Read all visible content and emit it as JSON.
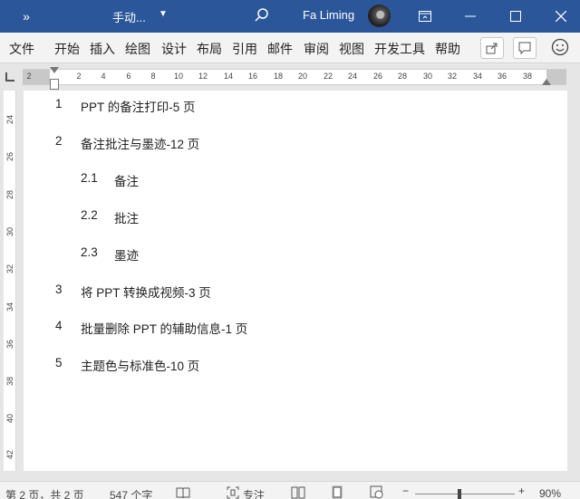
{
  "titlebar": {
    "qat_label": "»",
    "title": "手动...",
    "user_name": "Fa Liming",
    "colors": {
      "bg": "#2b579a"
    }
  },
  "ribbon": {
    "tabs": [
      "文件",
      "开始",
      "插入",
      "绘图",
      "设计",
      "布局",
      "引用",
      "邮件",
      "审阅",
      "视图",
      "开发工具",
      "帮助"
    ]
  },
  "ruler": {
    "h_numbers": [
      "2",
      "2",
      "4",
      "6",
      "8",
      "10",
      "12",
      "14",
      "16",
      "18",
      "20",
      "22",
      "24",
      "26",
      "28",
      "30",
      "32",
      "34",
      "36",
      "38"
    ],
    "v_numbers": [
      "24",
      "26",
      "28",
      "30",
      "32",
      "34",
      "36",
      "38",
      "40",
      "42"
    ]
  },
  "document": {
    "toc": [
      {
        "num": "1",
        "text": "PPT 的备注打印-5 页"
      },
      {
        "num": "2",
        "text": "备注批注与墨迹-12 页"
      },
      {
        "num": "2.1",
        "text": "备注"
      },
      {
        "num": "2.2",
        "text": "批注"
      },
      {
        "num": "2.3",
        "text": "墨迹"
      },
      {
        "num": "3",
        "text": "将 PPT 转换成视频-3 页"
      },
      {
        "num": "4",
        "text": "批量删除 PPT 的辅助信息-1 页"
      },
      {
        "num": "5",
        "text": "主题色与标准色-10 页"
      }
    ]
  },
  "statusbar": {
    "page_info": "第 2 页，共 2 页",
    "word_count": "547 个字",
    "focus_label": "专注",
    "zoom_minus": "−",
    "zoom_plus": "+",
    "zoom_level": "90%"
  }
}
